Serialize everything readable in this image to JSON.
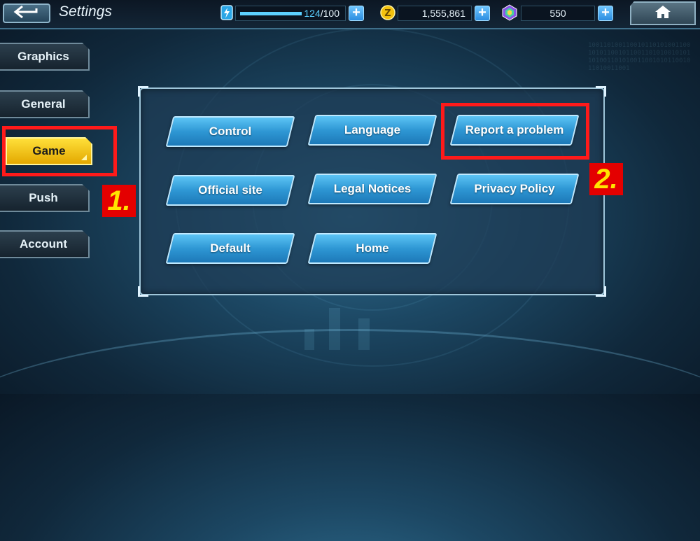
{
  "header": {
    "title": "Settings",
    "stamina": {
      "current": "124",
      "max": "/100",
      "fill_fraction": 1.0
    },
    "coins": "1,555,861",
    "gems": "550"
  },
  "sidebar": {
    "tabs": [
      {
        "label": "Graphics",
        "active": false
      },
      {
        "label": "General",
        "active": false
      },
      {
        "label": "Game",
        "active": true
      },
      {
        "label": "Push",
        "active": false
      },
      {
        "label": "Account",
        "active": false
      }
    ]
  },
  "menu": {
    "buttons": [
      "Control",
      "Language",
      "Report a problem",
      "Official site",
      "Legal Notices",
      "Privacy Policy",
      "Default",
      "Home"
    ]
  },
  "annotations": {
    "step1": "1.",
    "step2": "2."
  },
  "colors": {
    "accent_blue": "#2e97d4",
    "active_tab": "#ffd21a",
    "highlight_red": "#ff1a1a",
    "step_text": "#ffe400"
  }
}
